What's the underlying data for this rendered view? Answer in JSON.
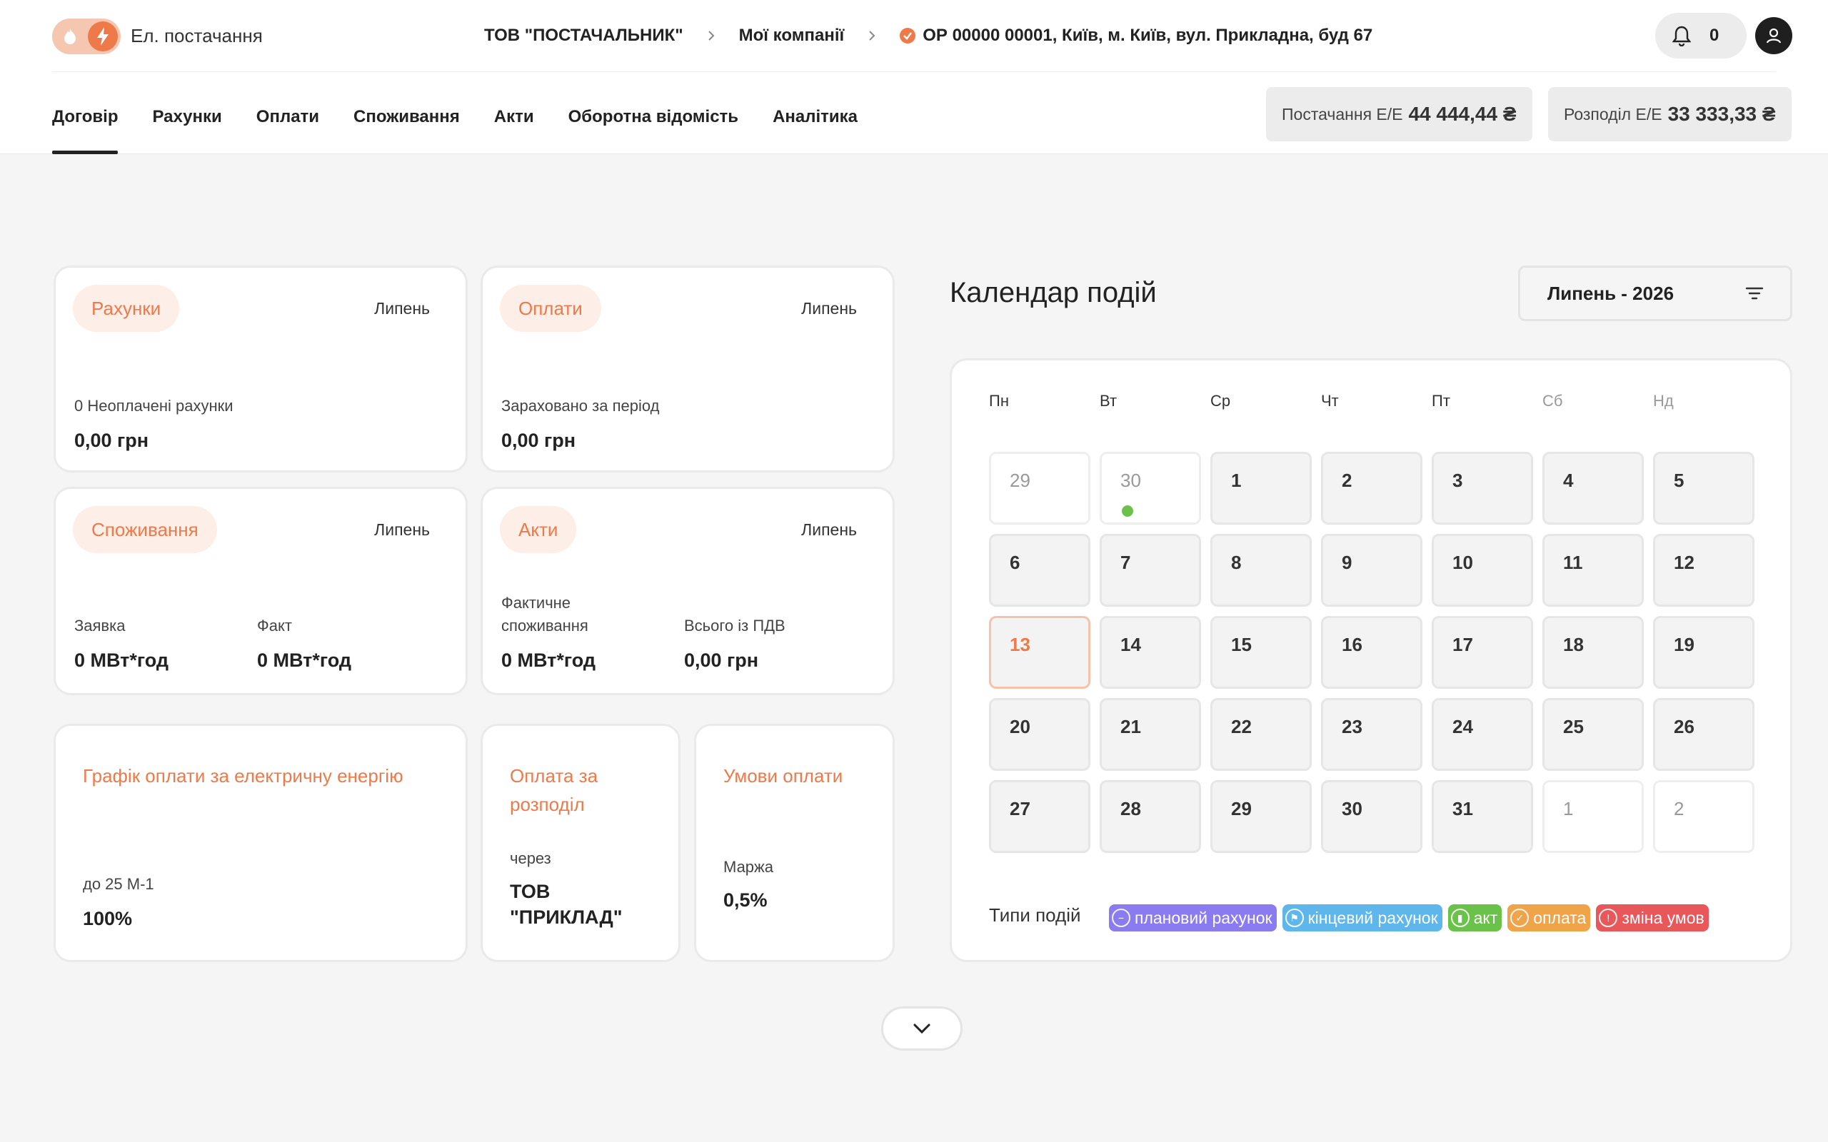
{
  "header": {
    "app_title": "Ел. постачання",
    "breadcrumbs": {
      "company": "ТОВ \"ПОСТАЧАЛЬНИК\"",
      "my_companies": "Мої компанії",
      "account": "ОР 00000 00001, Київ, м. Київ, вул. Прикладна, буд 67"
    },
    "notifications_count": "0",
    "accent_color": "#ee7a4a"
  },
  "tabs": [
    "Договір",
    "Рахунки",
    "Оплати",
    "Споживання",
    "Акти",
    "Оборотна відомість",
    "Аналітика"
  ],
  "active_tab": "Договір",
  "balances": {
    "supply": {
      "label": "Постачання Е/Е",
      "value": "44 444,44 ₴"
    },
    "distribution": {
      "label": "Розподіл Е/Е",
      "value": "33 333,33 ₴"
    }
  },
  "cards": {
    "invoices": {
      "title": "Рахунки",
      "month": "Липень",
      "label": "0 Неоплачені рахунки",
      "value": "0,00 грн"
    },
    "payments": {
      "title": "Оплати",
      "month": "Липень",
      "label": "Зараховано за період",
      "value": "0,00 грн"
    },
    "consumption": {
      "title": "Споживання",
      "month": "Липень",
      "request_label": "Заявка",
      "request_value": "0 МВт*год",
      "fact_label": "Факт",
      "fact_value": "0 МВт*год"
    },
    "acts": {
      "title": "Акти",
      "month": "Липень",
      "actual_label_1": "Фактичне",
      "actual_label_2": "споживання",
      "actual_value": "0 МВт*год",
      "total_label": "Всього із ПДВ",
      "total_value": "0,00 грн"
    },
    "payment_schedule": {
      "title": "Графік оплати за електричну енергію",
      "label": "до 25 М-1",
      "value": "100%"
    },
    "distribution_payment": {
      "title_1": "Оплата за",
      "title_2": "розподіл",
      "label": "через",
      "value_1": "ТОВ",
      "value_2": "\"ПРИКЛАД\""
    },
    "payment_terms": {
      "title": "Умови оплати",
      "label": "Маржа",
      "value": "0,5%"
    }
  },
  "calendar": {
    "title": "Календар подій",
    "period": "Липень - 2026",
    "weekdays": [
      "Пн",
      "Вт",
      "Ср",
      "Чт",
      "Пт",
      "Сб",
      "Нд"
    ],
    "weekend_days": [
      "Сб",
      "Нд"
    ],
    "days": [
      "29",
      "30",
      "1",
      "2",
      "3",
      "4",
      "5",
      "6",
      "7",
      "8",
      "9",
      "10",
      "11",
      "12",
      "13",
      "14",
      "15",
      "16",
      "17",
      "18",
      "19",
      "20",
      "21",
      "22",
      "23",
      "24",
      "25",
      "26",
      "27",
      "28",
      "29",
      "30",
      "31",
      "1",
      "2"
    ],
    "other_month_cells": [
      0,
      1,
      33,
      34
    ],
    "today_cell": 14,
    "event_cells": [
      {
        "cell": 1,
        "type": "акт"
      }
    ],
    "legend_label": "Типи подій",
    "event_types": [
      {
        "label": "плановий рахунок",
        "color": "#8a7cf0",
        "icon": "minus-circle-icon"
      },
      {
        "label": "кінцевий рахунок",
        "color": "#5fb6ea",
        "icon": "flag-circle-icon"
      },
      {
        "label": "акт",
        "color": "#6ac24a",
        "icon": "chart-circle-icon"
      },
      {
        "label": "оплата",
        "color": "#f0a44a",
        "icon": "check-circle-icon"
      },
      {
        "label": "зміна умов",
        "color": "#e8585a",
        "icon": "alert-circle-icon"
      }
    ]
  }
}
